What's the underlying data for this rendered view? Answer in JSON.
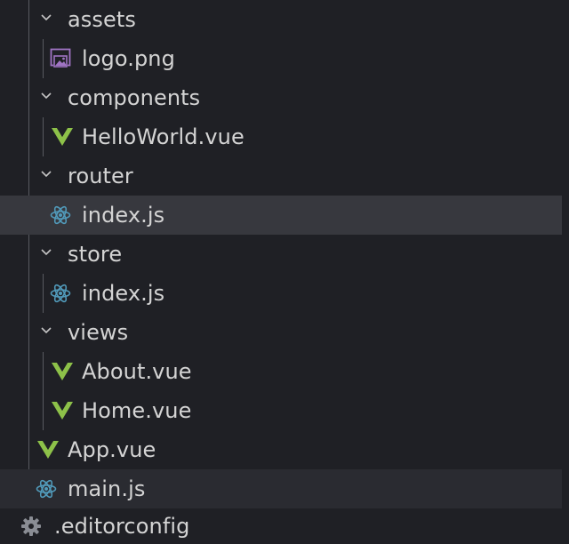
{
  "explorer": {
    "rows": [
      {
        "label": "assets",
        "kind": "folder"
      },
      {
        "label": "logo.png",
        "kind": "image"
      },
      {
        "label": "components",
        "kind": "folder"
      },
      {
        "label": "HelloWorld.vue",
        "kind": "vue"
      },
      {
        "label": "router",
        "kind": "folder"
      },
      {
        "label": "index.js",
        "kind": "react"
      },
      {
        "label": "store",
        "kind": "folder"
      },
      {
        "label": "index.js",
        "kind": "react"
      },
      {
        "label": "views",
        "kind": "folder"
      },
      {
        "label": "About.vue",
        "kind": "vue"
      },
      {
        "label": "Home.vue",
        "kind": "vue"
      },
      {
        "label": "App.vue",
        "kind": "vue"
      },
      {
        "label": "main.js",
        "kind": "react"
      },
      {
        "label": ".editorconfig",
        "kind": "gear"
      }
    ]
  },
  "colors": {
    "background": "#1f2025",
    "selected_row": "#37383e",
    "hover_row": "#2a2b31",
    "text": "#d4d4d4",
    "vue_green": "#8dc149",
    "react_blue": "#519aba",
    "image_purple": "#a074c4",
    "gear_gray": "#8a8d94"
  },
  "icons": {
    "folder_expanded": "chevron-down-icon",
    "image": "image-file-icon",
    "vue": "vue-file-icon",
    "react": "react-file-icon",
    "gear": "gear-icon"
  }
}
